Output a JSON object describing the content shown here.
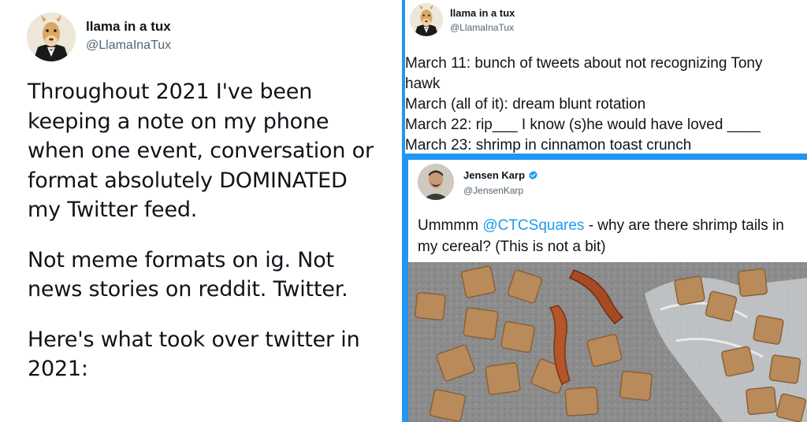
{
  "left_tweet": {
    "display_name": "llama in a tux",
    "handle": "@LlamaInaTux",
    "paragraphs": [
      "Throughout 2021 I've been keeping a note on my phone when one event, conversation or format absolutely DOMINATED my Twitter feed.",
      "Not meme formats on ig. Not news stories on reddit. Twitter.",
      "Here's what took over twitter in 2021:"
    ]
  },
  "note_tweet": {
    "display_name": "llama in a tux",
    "handle": "@LlamaInaTux",
    "lines": [
      "March 11: bunch of tweets about not recognizing Tony",
      "hawk",
      "March (all of it): dream blunt rotation",
      "March 22: rip___ I know (s)he would have loved ____",
      "March 23: shrimp in cinnamon toast crunch"
    ]
  },
  "quoted_tweet": {
    "display_name": "Jensen Karp",
    "handle": "@JensenKarp",
    "text_before": "Ummmm ",
    "mention": "@CTCSquares",
    "text_after": " - why are there shrimp tails in my cereal? (This is not a bit)"
  },
  "colors": {
    "accent_blue": "#2196f3",
    "mention_blue": "#1d9bf0",
    "handle_gray": "#536471"
  },
  "icons": [
    "llama-avatar-icon",
    "verified-badge-icon",
    "jensen-avatar-icon"
  ]
}
